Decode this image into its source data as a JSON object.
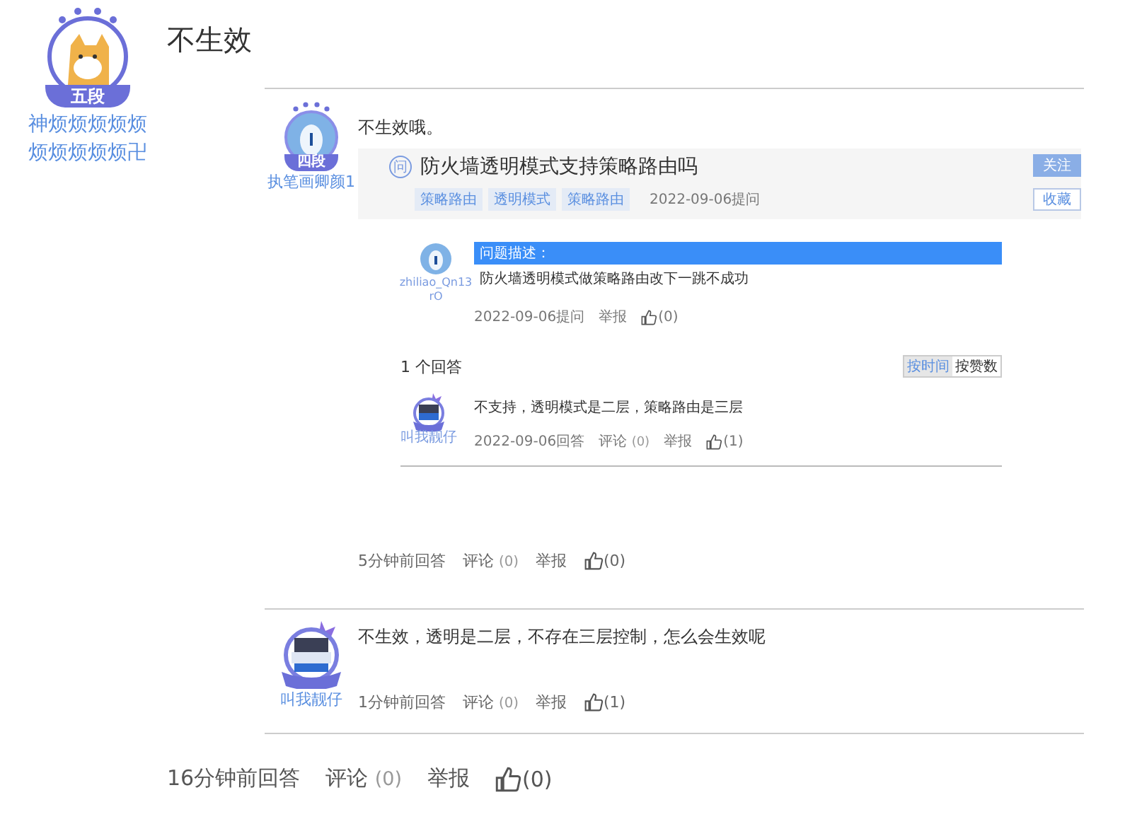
{
  "question": {
    "user": {
      "name": "神烦烦烦烦烦烦烦烦烦烦卍",
      "badge": "五段"
    },
    "text": "不生效"
  },
  "comments": [
    {
      "user": {
        "name": "执笔画卿颜1",
        "badge": "四段",
        "kind": "bear"
      },
      "text": "不生效哦。",
      "screenshot": {
        "header": {
          "icon": "问",
          "title": "防火墙透明模式支持策略路由吗",
          "tags": [
            "策略路由",
            "透明模式",
            "策略路由"
          ],
          "date": "2022-09-06提问",
          "buttons": [
            {
              "label": "关注",
              "kind": "primary"
            },
            {
              "label": "收藏",
              "kind": "plain"
            }
          ]
        },
        "question": {
          "user": "zhiliao_Qn13rO",
          "label": "问题描述：",
          "text": "防火墙透明模式做策略路由改下一跳不成功",
          "date": "2022-09-06提问",
          "report": "举报",
          "likes": "(0)"
        },
        "answers_title": "1 个回答",
        "sort": [
          {
            "label": "按时间",
            "selected": true
          },
          {
            "label": "按赞数",
            "selected": false
          }
        ],
        "answer": {
          "user": "叫我靓仔",
          "text": "不支持，透明模式是二层，策略路由是三层",
          "date": "2022-09-06回答",
          "comment": "评论",
          "comment_count": "(0)",
          "report": "举报",
          "likes": "(1)"
        }
      },
      "meta": {
        "time": "5分钟前回答",
        "comment": "评论",
        "comment_count": "(0)",
        "report": "举报",
        "likes": "(0)"
      }
    },
    {
      "user": {
        "name": "叫我靓仔",
        "kind": "crown"
      },
      "text": "不生效，透明是二层，不存在三层控制，怎么会生效呢",
      "meta": {
        "time": "1分钟前回答",
        "comment": "评论",
        "comment_count": "(0)",
        "report": "举报",
        "likes": "(1)"
      }
    }
  ],
  "meta": {
    "time": "16分钟前回答",
    "comment": "评论",
    "comment_count": "(0)",
    "report": "举报",
    "likes": "(0)"
  }
}
